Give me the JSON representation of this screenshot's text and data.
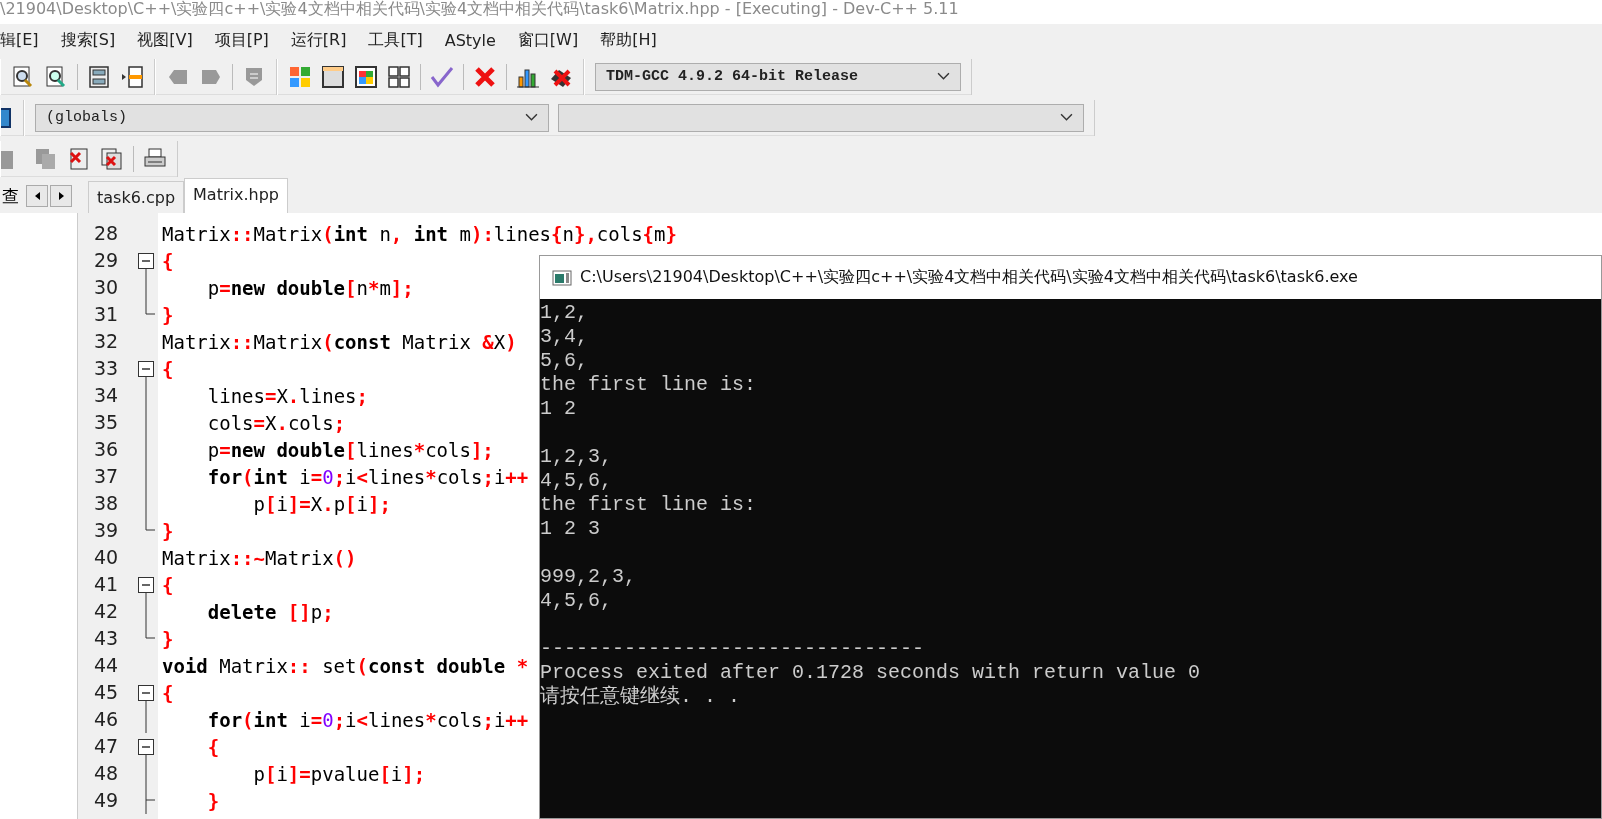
{
  "window": {
    "title": "\\21904\\Desktop\\C++\\实验四c++\\实验4文档中相关代码\\实验4文档中相关代码\\task6\\Matrix.hpp - [Executing] - Dev-C++ 5.11"
  },
  "menu": [
    "辑[E]",
    "搜索[S]",
    "视图[V]",
    "项目[P]",
    "运行[R]",
    "工具[T]",
    "AStyle",
    "窗口[W]",
    "帮助[H]"
  ],
  "compiler_select": {
    "value": "TDM-GCC 4.9.2 64-bit Release"
  },
  "scope_select": {
    "value": "(globals)"
  },
  "side_panel": {
    "tab": "查"
  },
  "tabs": [
    {
      "label": "task6.cpp",
      "selected": false
    },
    {
      "label": "Matrix.hpp",
      "selected": true
    }
  ],
  "code_lines": [
    {
      "number": "28",
      "tokens": [
        {
          "kind": "id",
          "text": "Matrix"
        },
        {
          "kind": "op",
          "text": "::"
        },
        {
          "kind": "id",
          "text": "Matrix"
        },
        {
          "kind": "op",
          "text": "("
        },
        {
          "kind": "kw",
          "text": "int"
        },
        {
          "kind": "id",
          "text": " n"
        },
        {
          "kind": "op",
          "text": ", "
        },
        {
          "kind": "kw",
          "text": "int"
        },
        {
          "kind": "id",
          "text": " m"
        },
        {
          "kind": "op",
          "text": "):"
        },
        {
          "kind": "id",
          "text": "lines"
        },
        {
          "kind": "op",
          "text": "{"
        },
        {
          "kind": "id",
          "text": "n"
        },
        {
          "kind": "op",
          "text": "},"
        },
        {
          "kind": "id",
          "text": "cols"
        },
        {
          "kind": "op",
          "text": "{"
        },
        {
          "kind": "id",
          "text": "m"
        },
        {
          "kind": "op",
          "text": "}"
        }
      ]
    },
    {
      "number": "29",
      "kind": "fold-start",
      "tokens": [
        {
          "kind": "op",
          "text": "{"
        }
      ]
    },
    {
      "number": "30",
      "kind": "fold-line",
      "tokens": [
        {
          "kind": "id",
          "text": "    p"
        },
        {
          "kind": "op",
          "text": "="
        },
        {
          "kind": "kw",
          "text": "new double"
        },
        {
          "kind": "op",
          "text": "["
        },
        {
          "kind": "id",
          "text": "n"
        },
        {
          "kind": "op",
          "text": "*"
        },
        {
          "kind": "id",
          "text": "m"
        },
        {
          "kind": "op",
          "text": "];"
        }
      ]
    },
    {
      "number": "31",
      "kind": "fold-end",
      "tokens": [
        {
          "kind": "op",
          "text": "}"
        }
      ]
    },
    {
      "number": "32",
      "tokens": [
        {
          "kind": "id",
          "text": "Matrix"
        },
        {
          "kind": "op",
          "text": "::"
        },
        {
          "kind": "id",
          "text": "Matrix"
        },
        {
          "kind": "op",
          "text": "("
        },
        {
          "kind": "kw",
          "text": "const"
        },
        {
          "kind": "id",
          "text": " Matrix "
        },
        {
          "kind": "op",
          "text": "&"
        },
        {
          "kind": "id",
          "text": "X"
        },
        {
          "kind": "op",
          "text": ")"
        }
      ]
    },
    {
      "number": "33",
      "kind": "fold-start",
      "tokens": [
        {
          "kind": "op",
          "text": "{"
        }
      ]
    },
    {
      "number": "34",
      "kind": "fold-line",
      "tokens": [
        {
          "kind": "id",
          "text": "    lines"
        },
        {
          "kind": "op",
          "text": "="
        },
        {
          "kind": "id",
          "text": "X"
        },
        {
          "kind": "op",
          "text": "."
        },
        {
          "kind": "id",
          "text": "lines"
        },
        {
          "kind": "op",
          "text": ";"
        }
      ]
    },
    {
      "number": "35",
      "kind": "fold-line",
      "tokens": [
        {
          "kind": "id",
          "text": "    cols"
        },
        {
          "kind": "op",
          "text": "="
        },
        {
          "kind": "id",
          "text": "X"
        },
        {
          "kind": "op",
          "text": "."
        },
        {
          "kind": "id",
          "text": "cols"
        },
        {
          "kind": "op",
          "text": ";"
        }
      ]
    },
    {
      "number": "36",
      "kind": "fold-line",
      "tokens": [
        {
          "kind": "id",
          "text": "    p"
        },
        {
          "kind": "op",
          "text": "="
        },
        {
          "kind": "kw",
          "text": "new double"
        },
        {
          "kind": "op",
          "text": "["
        },
        {
          "kind": "id",
          "text": "lines"
        },
        {
          "kind": "op",
          "text": "*"
        },
        {
          "kind": "id",
          "text": "cols"
        },
        {
          "kind": "op",
          "text": "];"
        }
      ]
    },
    {
      "number": "37",
      "kind": "fold-line",
      "tokens": [
        {
          "kind": "kw",
          "text": "    for"
        },
        {
          "kind": "op",
          "text": "("
        },
        {
          "kind": "kw",
          "text": "int"
        },
        {
          "kind": "id",
          "text": " i"
        },
        {
          "kind": "op",
          "text": "="
        },
        {
          "kind": "num",
          "text": "0"
        },
        {
          "kind": "op",
          "text": ";"
        },
        {
          "kind": "id",
          "text": "i"
        },
        {
          "kind": "op",
          "text": "<"
        },
        {
          "kind": "id",
          "text": "lines"
        },
        {
          "kind": "op",
          "text": "*"
        },
        {
          "kind": "id",
          "text": "cols"
        },
        {
          "kind": "op",
          "text": ";"
        },
        {
          "kind": "id",
          "text": "i"
        },
        {
          "kind": "op",
          "text": "++"
        }
      ]
    },
    {
      "number": "38",
      "kind": "fold-line",
      "tokens": [
        {
          "kind": "id",
          "text": "        p"
        },
        {
          "kind": "op",
          "text": "["
        },
        {
          "kind": "id",
          "text": "i"
        },
        {
          "kind": "op",
          "text": "]="
        },
        {
          "kind": "id",
          "text": "X"
        },
        {
          "kind": "op",
          "text": "."
        },
        {
          "kind": "id",
          "text": "p"
        },
        {
          "kind": "op",
          "text": "["
        },
        {
          "kind": "id",
          "text": "i"
        },
        {
          "kind": "op",
          "text": "];"
        }
      ]
    },
    {
      "number": "39",
      "kind": "fold-end",
      "tokens": [
        {
          "kind": "op",
          "text": "}"
        }
      ]
    },
    {
      "number": "40",
      "tokens": [
        {
          "kind": "id",
          "text": "Matrix"
        },
        {
          "kind": "op",
          "text": "::~"
        },
        {
          "kind": "id",
          "text": "Matrix"
        },
        {
          "kind": "op",
          "text": "()"
        }
      ]
    },
    {
      "number": "41",
      "kind": "fold-start",
      "tokens": [
        {
          "kind": "op",
          "text": "{"
        }
      ]
    },
    {
      "number": "42",
      "kind": "fold-line",
      "tokens": [
        {
          "kind": "kw",
          "text": "    delete"
        },
        {
          "kind": "op",
          "text": " []"
        },
        {
          "kind": "id",
          "text": "p"
        },
        {
          "kind": "op",
          "text": ";"
        }
      ]
    },
    {
      "number": "43",
      "kind": "fold-end",
      "tokens": [
        {
          "kind": "op",
          "text": "}"
        }
      ]
    },
    {
      "number": "44",
      "tokens": [
        {
          "kind": "kw",
          "text": "void"
        },
        {
          "kind": "id",
          "text": " Matrix"
        },
        {
          "kind": "op",
          "text": "::"
        },
        {
          "kind": "id",
          "text": " set"
        },
        {
          "kind": "op",
          "text": "("
        },
        {
          "kind": "kw",
          "text": "const double"
        },
        {
          "kind": "op",
          "text": " *"
        }
      ]
    },
    {
      "number": "45",
      "kind": "fold-start",
      "tokens": [
        {
          "kind": "op",
          "text": "{"
        }
      ]
    },
    {
      "number": "46",
      "kind": "fold-line",
      "tokens": [
        {
          "kind": "kw",
          "text": "    for"
        },
        {
          "kind": "op",
          "text": "("
        },
        {
          "kind": "kw",
          "text": "int"
        },
        {
          "kind": "id",
          "text": " i"
        },
        {
          "kind": "op",
          "text": "="
        },
        {
          "kind": "num",
          "text": "0"
        },
        {
          "kind": "op",
          "text": ";"
        },
        {
          "kind": "id",
          "text": "i"
        },
        {
          "kind": "op",
          "text": "<"
        },
        {
          "kind": "id",
          "text": "lines"
        },
        {
          "kind": "op",
          "text": "*"
        },
        {
          "kind": "id",
          "text": "cols"
        },
        {
          "kind": "op",
          "text": ";"
        },
        {
          "kind": "id",
          "text": "i"
        },
        {
          "kind": "op",
          "text": "++"
        }
      ]
    },
    {
      "number": "47",
      "kind": "fold-start",
      "tokens": [
        {
          "kind": "op",
          "text": "    {"
        }
      ]
    },
    {
      "number": "48",
      "kind": "fold-line",
      "tokens": [
        {
          "kind": "id",
          "text": "        p"
        },
        {
          "kind": "op",
          "text": "["
        },
        {
          "kind": "id",
          "text": "i"
        },
        {
          "kind": "op",
          "text": "]="
        },
        {
          "kind": "id",
          "text": "pvalue"
        },
        {
          "kind": "op",
          "text": "["
        },
        {
          "kind": "id",
          "text": "i"
        },
        {
          "kind": "op",
          "text": "];"
        }
      ]
    },
    {
      "number": "49",
      "kind": "fold-branch",
      "tokens": [
        {
          "kind": "op",
          "text": "    }"
        }
      ]
    }
  ],
  "console": {
    "title": "C:\\Users\\21904\\Desktop\\C++\\实验四c++\\实验4文档中相关代码\\实验4文档中相关代码\\task6\\task6.exe",
    "blocks": [
      [
        "1,2,",
        "3,4,",
        "5,6,",
        "the first line is:",
        "1 2"
      ],
      [
        "1,2,3,",
        "4,5,6,",
        "the first line is:",
        "1 2 3"
      ],
      [
        "999,2,3,",
        "4,5,6,"
      ],
      [
        "--------------------------------",
        "Process exited after 0.1728 seconds with return value 0",
        "请按任意键继续. . ."
      ]
    ]
  }
}
